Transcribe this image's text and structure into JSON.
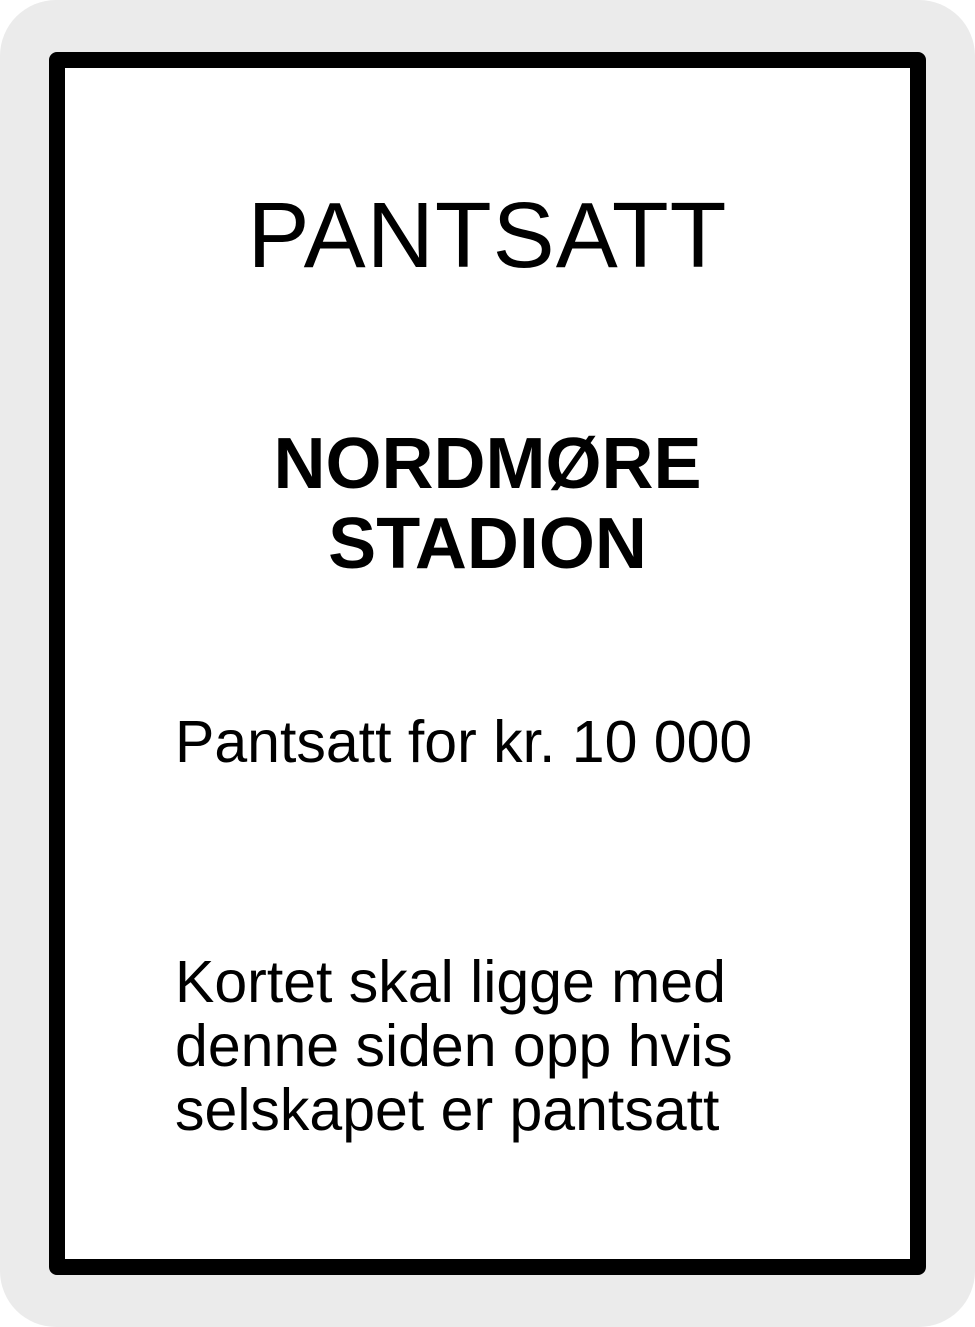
{
  "card": {
    "header": "PANTSATT",
    "property_name_lines": [
      "NORDMØRE",
      "STADION"
    ],
    "mortgage_text": "Pantsatt for kr. 10 000",
    "instruction_lines": [
      "Kortet skal ligge med",
      "denne siden opp hvis",
      "selskapet er pantsatt"
    ],
    "colors": {
      "outer_background": "#ebebeb",
      "frame": "#000000",
      "card_background": "#ffffff",
      "text": "#000000"
    }
  }
}
